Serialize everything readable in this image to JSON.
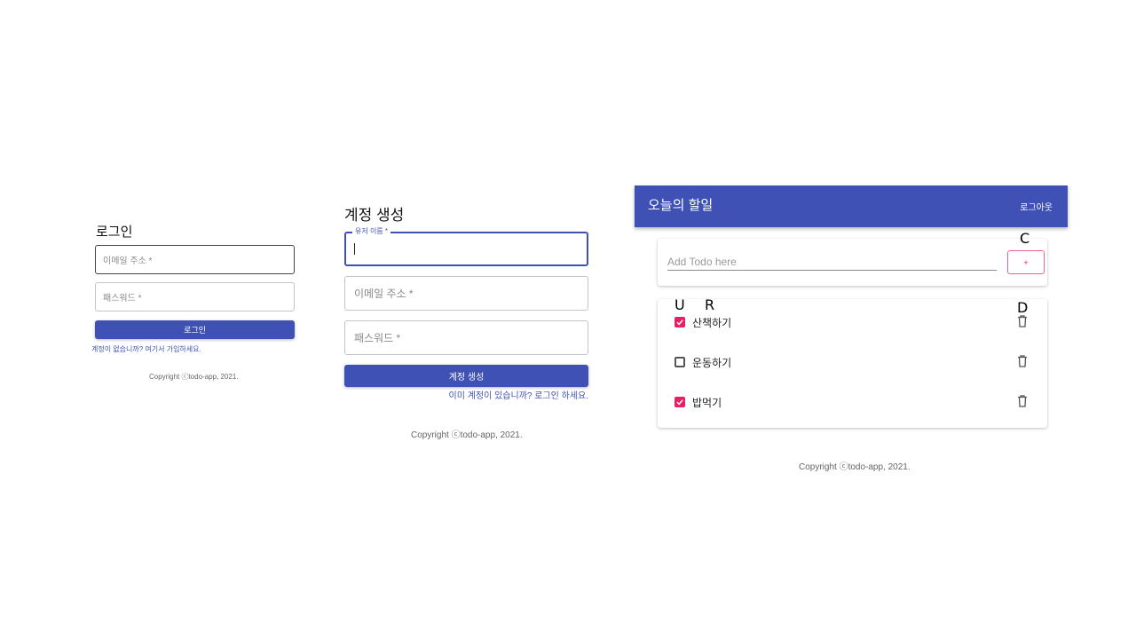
{
  "login": {
    "title": "로그인",
    "email_placeholder": "이메일 주소 *",
    "password_placeholder": "패스워드 *",
    "submit_label": "로그인",
    "signup_link": "계정이 없습니까? 여기서 가입하세요.",
    "copyright": "Copyright ⓒtodo-app, 2021."
  },
  "signup": {
    "title": "계정 생성",
    "username_label": "유저 이름 *",
    "username_value": "",
    "email_placeholder": "이메일 주소 *",
    "password_placeholder": "패스워드 *",
    "submit_label": "계정 생성",
    "login_link": "이미 계정이 있습니까? 로그인 하세요.",
    "copyright": "Copyright ⓒtodo-app, 2021."
  },
  "todo": {
    "app_title": "오늘의 할일",
    "logout_label": "로그아웃",
    "add_placeholder": "Add Todo here",
    "add_button_label": "+",
    "items": [
      {
        "text": "산책하기",
        "done": true
      },
      {
        "text": "운동하기",
        "done": false
      },
      {
        "text": "밥먹기",
        "done": true
      }
    ],
    "copyright": "Copyright ⓒtodo-app, 2021."
  },
  "annotations": {
    "create": "C",
    "update": "U",
    "read": "R",
    "delete": "D"
  },
  "colors": {
    "primary": "#3f51b5",
    "accent": "#e91e63"
  },
  "icons": {
    "checkbox_checked": "check-box-icon",
    "checkbox_unchecked": "check-box-outline-icon",
    "delete": "trash-icon"
  }
}
